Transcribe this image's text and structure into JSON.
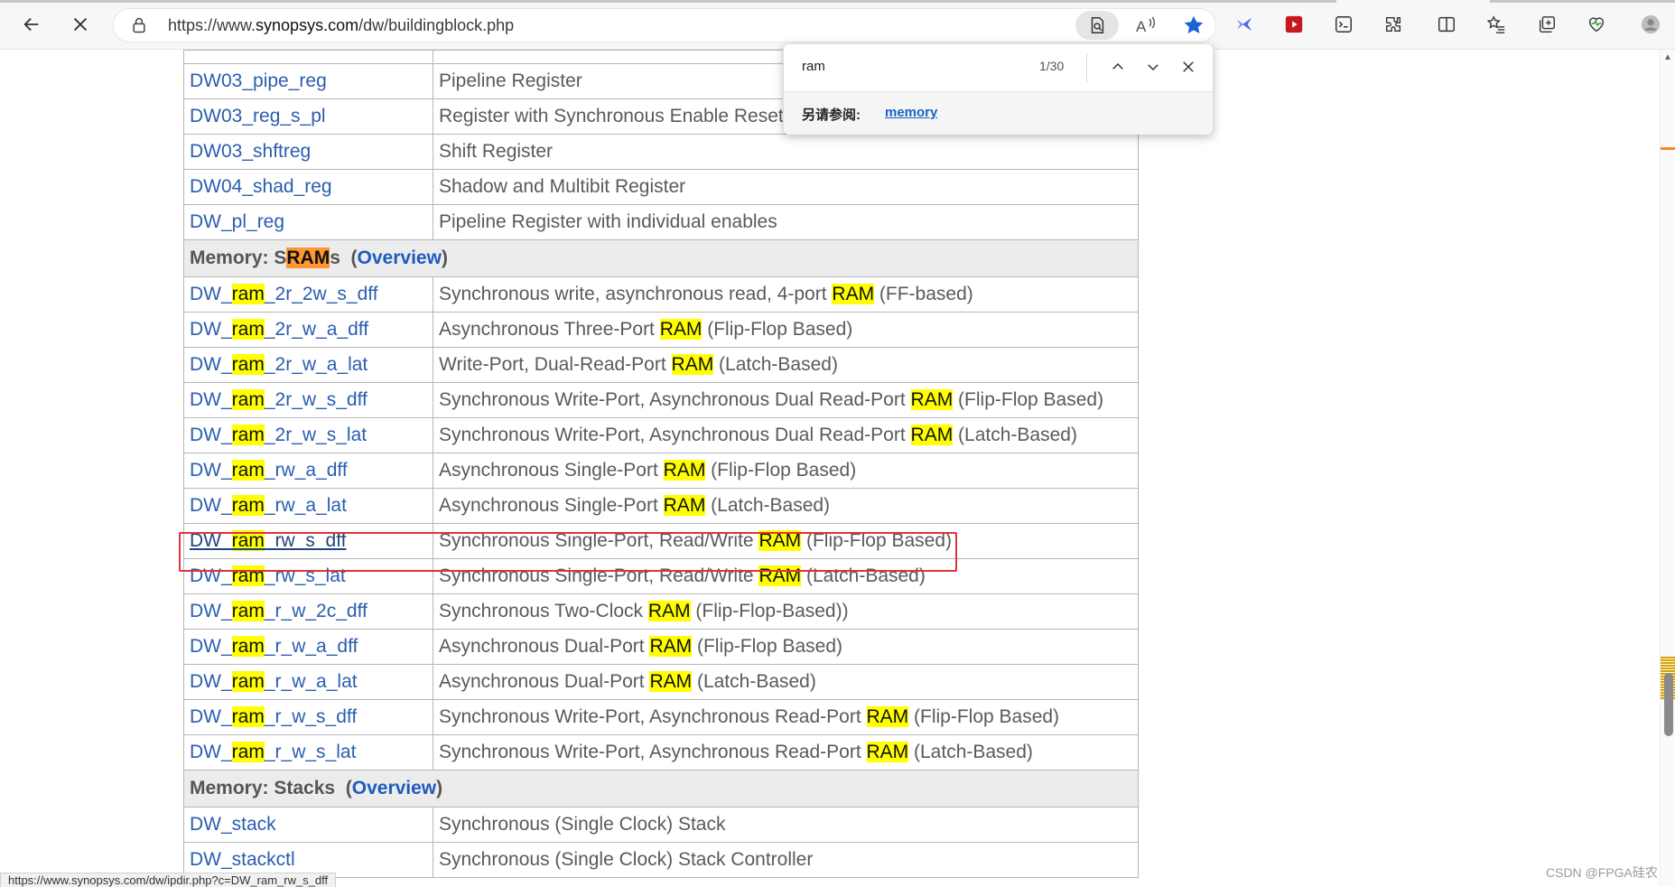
{
  "browser": {
    "url_prefix": "https://www.",
    "url_domain": "synopsys.com",
    "url_path": "/dw/buildingblock.php"
  },
  "find_bar": {
    "query": "ram",
    "count": "1/30",
    "see_also_label": "另请参阅:",
    "suggestion": "memory"
  },
  "table": {
    "rows": [
      {
        "kind": "cut",
        "name": "DW03_pipe_reg",
        "desc": "Pipeline Register",
        "visible": "top-clip"
      },
      {
        "kind": "item",
        "name": "DW03_pipe_reg",
        "desc": "Pipeline Register"
      },
      {
        "kind": "item",
        "name": "DW03_reg_s_pl",
        "desc": "Register with Synchronous Enable Reset"
      },
      {
        "kind": "item",
        "name": "DW03_shftreg",
        "desc": "Shift Register"
      },
      {
        "kind": "item",
        "name": "DW04_shad_reg",
        "desc": "Shadow and Multibit Register"
      },
      {
        "kind": "item",
        "name": "DW_pl_reg",
        "desc": "Pipeline Register with individual enables"
      },
      {
        "kind": "section",
        "title": "Memory: SRAMs",
        "link": "Overview"
      },
      {
        "kind": "item",
        "name": "DW_ram_2r_2w_s_dff",
        "desc": "Synchronous write, asynchronous read, 4-port RAM (FF-based)"
      },
      {
        "kind": "item",
        "name": "DW_ram_2r_w_a_dff",
        "desc": "Asynchronous Three-Port RAM (Flip-Flop Based)"
      },
      {
        "kind": "item",
        "name": "DW_ram_2r_w_a_lat",
        "desc": "Write-Port, Dual-Read-Port RAM (Latch-Based)"
      },
      {
        "kind": "item",
        "name": "DW_ram_2r_w_s_dff",
        "desc": "Synchronous Write-Port, Asynchronous Dual Read-Port RAM (Flip-Flop Based)"
      },
      {
        "kind": "item",
        "name": "DW_ram_2r_w_s_lat",
        "desc": "Synchronous Write-Port, Asynchronous Dual Read-Port RAM (Latch-Based)"
      },
      {
        "kind": "item",
        "name": "DW_ram_rw_a_dff",
        "desc": "Asynchronous Single-Port RAM (Flip-Flop Based)"
      },
      {
        "kind": "item",
        "name": "DW_ram_rw_a_lat",
        "desc": "Asynchronous Single-Port RAM (Latch-Based)"
      },
      {
        "kind": "item",
        "name": "DW_ram_rw_s_dff",
        "desc": "Synchronous Single-Port, Read/Write RAM (Flip-Flop Based)",
        "hover": true
      },
      {
        "kind": "item",
        "name": "DW_ram_rw_s_lat",
        "desc": "Synchronous Single-Port, Read/Write RAM (Latch-Based)"
      },
      {
        "kind": "item",
        "name": "DW_ram_r_w_2c_dff",
        "desc": "Synchronous Two-Clock RAM (Flip-Flop-Based))"
      },
      {
        "kind": "item",
        "name": "DW_ram_r_w_a_dff",
        "desc": "Asynchronous Dual-Port RAM (Flip-Flop Based)"
      },
      {
        "kind": "item",
        "name": "DW_ram_r_w_a_lat",
        "desc": "Asynchronous Dual-Port RAM (Latch-Based)"
      },
      {
        "kind": "item",
        "name": "DW_ram_r_w_s_dff",
        "desc": "Synchronous Write-Port, Asynchronous Read-Port RAM (Flip-Flop Based)"
      },
      {
        "kind": "item",
        "name": "DW_ram_r_w_s_lat",
        "desc": "Synchronous Write-Port, Asynchronous Read-Port RAM (Latch-Based)"
      },
      {
        "kind": "section",
        "title": "Memory: Stacks",
        "link": "Overview"
      },
      {
        "kind": "item",
        "name": "DW_stack",
        "desc": "Synchronous (Single Clock) Stack"
      },
      {
        "kind": "item",
        "name": "DW_stackctl",
        "desc": "Synchronous (Single Clock) Stack Controller"
      }
    ]
  },
  "status_bar": {
    "url": "https://www.synopsys.com/dw/ipdir.php?c=DW_ram_rw_s_dff"
  },
  "watermark": "CSDN @FPGA硅农",
  "colors": {
    "highlight": "#ffff00",
    "current_match": "#ff9632",
    "link": "#2a5db0",
    "annotation_box": "#e0333c"
  }
}
